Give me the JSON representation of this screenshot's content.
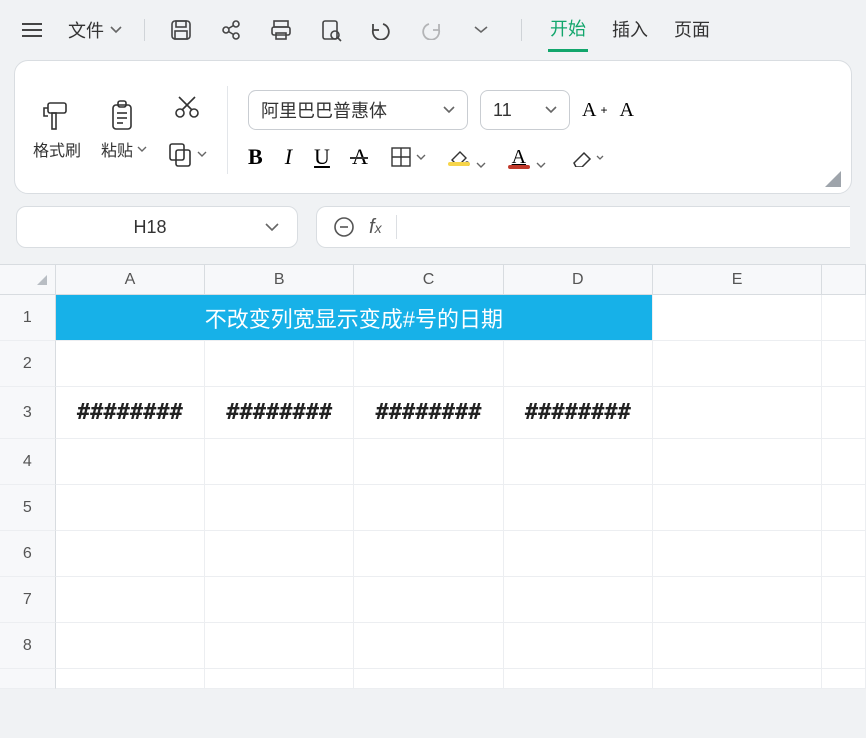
{
  "menu": {
    "hamburger": "☰",
    "file_label": "文件",
    "undo": "↶",
    "redo": "↷",
    "tabs": {
      "start": "开始",
      "insert": "插入",
      "page": "页面"
    }
  },
  "ribbon": {
    "format_painter": "格式刷",
    "paste": "粘贴",
    "font_name": "阿里巴巴普惠体",
    "font_size": "11",
    "increase_font": "A⁺",
    "decrease_font": "A",
    "bold": "B",
    "italic": "I",
    "underline": "U"
  },
  "name_box": {
    "ref": "H18"
  },
  "formula_bar": {
    "fx": "fx"
  },
  "grid": {
    "columns": [
      "A",
      "B",
      "C",
      "D",
      "E"
    ],
    "rows": [
      "1",
      "2",
      "3",
      "4",
      "5",
      "6",
      "7",
      "8"
    ],
    "merged_title": "不改变列宽显示变成#号的日期",
    "row3": {
      "A": "########",
      "B": "########",
      "C": "########",
      "D": "########"
    }
  }
}
